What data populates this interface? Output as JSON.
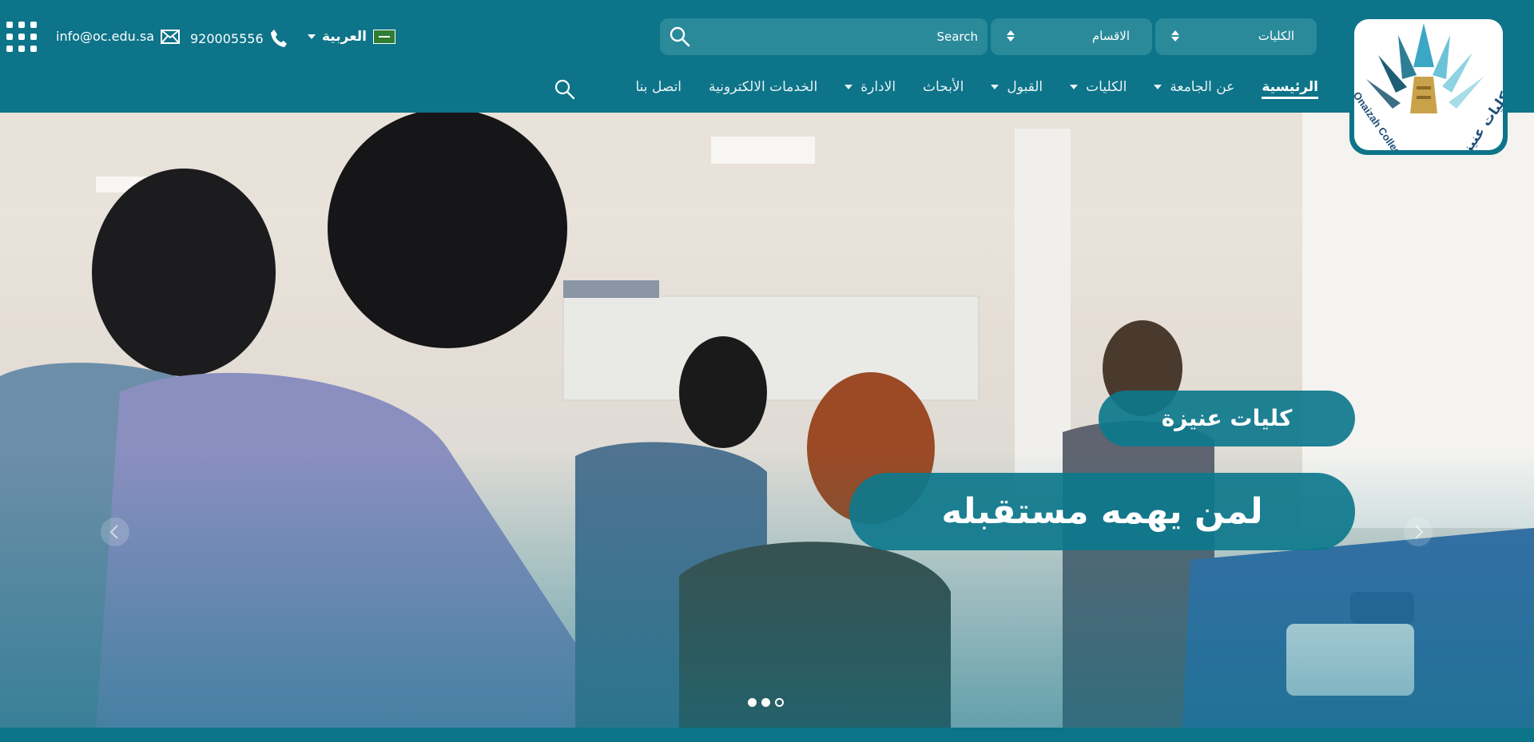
{
  "header": {
    "email": "info@oc.edu.sa",
    "phone": "920005556",
    "language": "العربية",
    "search": {
      "placeholder": "Search"
    },
    "departments_select": "الاقسام",
    "colleges_select": "الكليات"
  },
  "nav": {
    "items": [
      {
        "label": "الرئيسية",
        "dropdown": false,
        "active": true
      },
      {
        "label": "عن الجامعة",
        "dropdown": true
      },
      {
        "label": "الكليات",
        "dropdown": true
      },
      {
        "label": "القبول",
        "dropdown": true
      },
      {
        "label": "الأبحاث",
        "dropdown": false
      },
      {
        "label": "الادارة",
        "dropdown": true
      },
      {
        "label": "الخدمات الالكترونية",
        "dropdown": false
      },
      {
        "label": "اتصل بنا",
        "dropdown": false
      }
    ]
  },
  "logo": {
    "arabic": "كليات عنيزة",
    "english": "Onaizah Colleges"
  },
  "hero": {
    "title_small": "كليات عنيزة",
    "title_large": "لمن يهمه مستقبله",
    "slide_count": 3,
    "active_slide": 3
  },
  "colors": {
    "primary": "#0d7489",
    "pill": "#0d788c",
    "text": "#ffffff"
  },
  "icons": [
    "apps-grid-icon",
    "mail-icon",
    "phone-icon",
    "flag-icon",
    "search-icon",
    "sort-icon",
    "chevron-left-icon",
    "chevron-right-icon"
  ]
}
